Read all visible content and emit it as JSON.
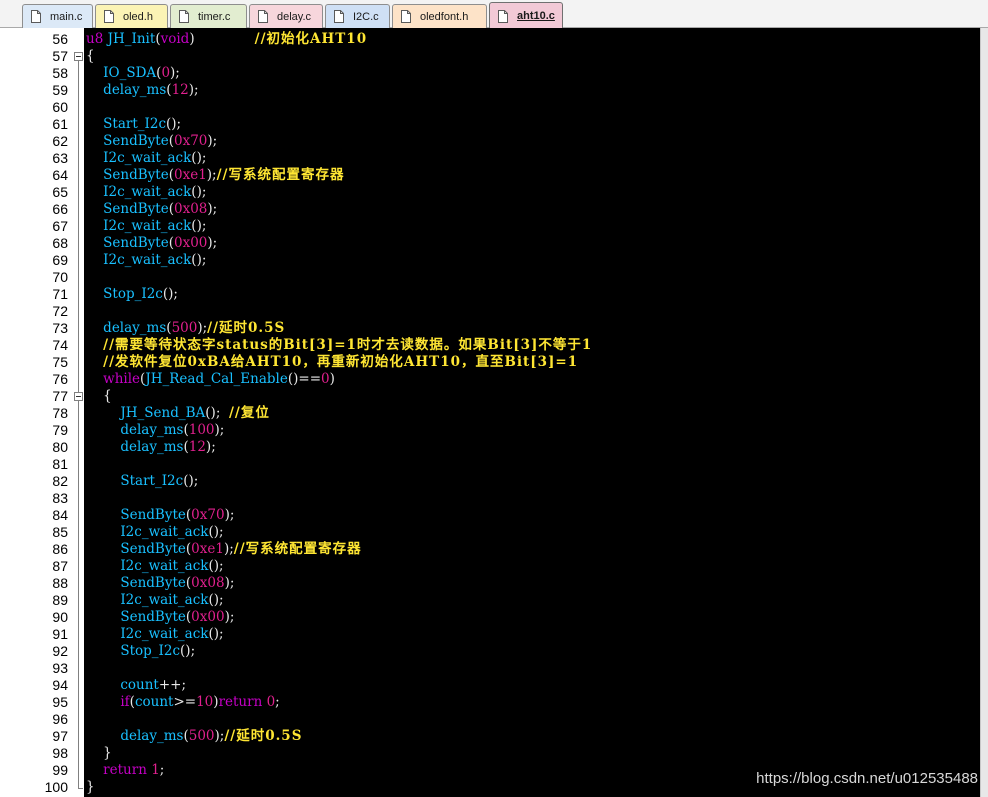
{
  "tabs": [
    {
      "label": "main.c",
      "color": "#dce9f7",
      "active": false
    },
    {
      "label": "oled.h",
      "color": "#fbf3b5",
      "active": false
    },
    {
      "label": "timer.c",
      "color": "#e2edd0",
      "active": false
    },
    {
      "label": "delay.c",
      "color": "#f7d6dc",
      "active": false
    },
    {
      "label": "I2C.c",
      "color": "#cfe0f5",
      "active": false
    },
    {
      "label": "oledfont.h",
      "color": "#fde3c8",
      "active": false
    },
    {
      "label": "aht10.c",
      "color": "#f2c9d6",
      "active": true
    }
  ],
  "editor": {
    "background": "#000000",
    "first_line": 56,
    "lines": [
      {
        "n": "56",
        "indent": "",
        "tokens": [
          [
            "kw",
            "u8"
          ],
          [
            "pun",
            " "
          ],
          [
            "fn",
            "JH_Init"
          ],
          [
            "pun",
            "("
          ],
          [
            "kw",
            "void"
          ],
          [
            "pun",
            ")"
          ],
          [
            "pun",
            "              "
          ],
          [
            "cmt",
            "//初始化AHT10"
          ]
        ]
      },
      {
        "n": "57",
        "indent": "",
        "tokens": [
          [
            "pun",
            "{"
          ]
        ]
      },
      {
        "n": "58",
        "indent": "    ",
        "tokens": [
          [
            "fn",
            "IO_SDA"
          ],
          [
            "pun",
            "("
          ],
          [
            "num",
            "0"
          ],
          [
            "pun",
            ");"
          ]
        ]
      },
      {
        "n": "59",
        "indent": "    ",
        "tokens": [
          [
            "fn",
            "delay_ms"
          ],
          [
            "pun",
            "("
          ],
          [
            "num",
            "12"
          ],
          [
            "pun",
            ");"
          ]
        ]
      },
      {
        "n": "60",
        "indent": "",
        "tokens": []
      },
      {
        "n": "61",
        "indent": "    ",
        "tokens": [
          [
            "fn",
            "Start_I2c"
          ],
          [
            "pun",
            "();"
          ]
        ]
      },
      {
        "n": "62",
        "indent": "    ",
        "tokens": [
          [
            "fn",
            "SendByte"
          ],
          [
            "pun",
            "("
          ],
          [
            "num",
            "0x70"
          ],
          [
            "pun",
            ");"
          ]
        ]
      },
      {
        "n": "63",
        "indent": "    ",
        "tokens": [
          [
            "fn",
            "I2c_wait_ack"
          ],
          [
            "pun",
            "();"
          ]
        ]
      },
      {
        "n": "64",
        "indent": "    ",
        "tokens": [
          [
            "fn",
            "SendByte"
          ],
          [
            "pun",
            "("
          ],
          [
            "num",
            "0xe1"
          ],
          [
            "pun",
            ");"
          ],
          [
            "cmt",
            "//写系统配置寄存器"
          ]
        ]
      },
      {
        "n": "65",
        "indent": "    ",
        "tokens": [
          [
            "fn",
            "I2c_wait_ack"
          ],
          [
            "pun",
            "();"
          ]
        ]
      },
      {
        "n": "66",
        "indent": "    ",
        "tokens": [
          [
            "fn",
            "SendByte"
          ],
          [
            "pun",
            "("
          ],
          [
            "num",
            "0x08"
          ],
          [
            "pun",
            ");"
          ]
        ]
      },
      {
        "n": "67",
        "indent": "    ",
        "tokens": [
          [
            "fn",
            "I2c_wait_ack"
          ],
          [
            "pun",
            "();"
          ]
        ]
      },
      {
        "n": "68",
        "indent": "    ",
        "tokens": [
          [
            "fn",
            "SendByte"
          ],
          [
            "pun",
            "("
          ],
          [
            "num",
            "0x00"
          ],
          [
            "pun",
            ");"
          ]
        ]
      },
      {
        "n": "69",
        "indent": "    ",
        "tokens": [
          [
            "fn",
            "I2c_wait_ack"
          ],
          [
            "pun",
            "();"
          ]
        ]
      },
      {
        "n": "70",
        "indent": "",
        "tokens": []
      },
      {
        "n": "71",
        "indent": "    ",
        "tokens": [
          [
            "fn",
            "Stop_I2c"
          ],
          [
            "pun",
            "();"
          ]
        ]
      },
      {
        "n": "72",
        "indent": "",
        "tokens": []
      },
      {
        "n": "73",
        "indent": "    ",
        "tokens": [
          [
            "fn",
            "delay_ms"
          ],
          [
            "pun",
            "("
          ],
          [
            "num",
            "500"
          ],
          [
            "pun",
            ");"
          ],
          [
            "cmt",
            "//延时0.5S"
          ]
        ]
      },
      {
        "n": "74",
        "indent": "    ",
        "tokens": [
          [
            "cmt",
            "//需要等待状态字status的Bit[3]=1时才去读数据。如果Bit[3]不等于1"
          ]
        ]
      },
      {
        "n": "75",
        "indent": "    ",
        "tokens": [
          [
            "cmt",
            "//发软件复位0xBA给AHT10，再重新初始化AHT10，直至Bit[3]=1"
          ]
        ]
      },
      {
        "n": "76",
        "indent": "    ",
        "tokens": [
          [
            "kw",
            "while"
          ],
          [
            "pun",
            "("
          ],
          [
            "fn",
            "JH_Read_Cal_Enable"
          ],
          [
            "pun",
            "()=="
          ],
          [
            "num",
            "0"
          ],
          [
            "pun",
            ")"
          ]
        ]
      },
      {
        "n": "77",
        "indent": "    ",
        "tokens": [
          [
            "pun",
            "{"
          ]
        ]
      },
      {
        "n": "78",
        "indent": "        ",
        "tokens": [
          [
            "fn",
            "JH_Send_BA"
          ],
          [
            "pun",
            "();  "
          ],
          [
            "cmt",
            "//复位"
          ]
        ]
      },
      {
        "n": "79",
        "indent": "        ",
        "tokens": [
          [
            "fn",
            "delay_ms"
          ],
          [
            "pun",
            "("
          ],
          [
            "num",
            "100"
          ],
          [
            "pun",
            ");"
          ]
        ]
      },
      {
        "n": "80",
        "indent": "        ",
        "tokens": [
          [
            "fn",
            "delay_ms"
          ],
          [
            "pun",
            "("
          ],
          [
            "num",
            "12"
          ],
          [
            "pun",
            ");"
          ]
        ]
      },
      {
        "n": "81",
        "indent": "",
        "tokens": []
      },
      {
        "n": "82",
        "indent": "        ",
        "tokens": [
          [
            "fn",
            "Start_I2c"
          ],
          [
            "pun",
            "();"
          ]
        ]
      },
      {
        "n": "83",
        "indent": "",
        "tokens": []
      },
      {
        "n": "84",
        "indent": "        ",
        "tokens": [
          [
            "fn",
            "SendByte"
          ],
          [
            "pun",
            "("
          ],
          [
            "num",
            "0x70"
          ],
          [
            "pun",
            ");"
          ]
        ]
      },
      {
        "n": "85",
        "indent": "        ",
        "tokens": [
          [
            "fn",
            "I2c_wait_ack"
          ],
          [
            "pun",
            "();"
          ]
        ]
      },
      {
        "n": "86",
        "indent": "        ",
        "tokens": [
          [
            "fn",
            "SendByte"
          ],
          [
            "pun",
            "("
          ],
          [
            "num",
            "0xe1"
          ],
          [
            "pun",
            ");"
          ],
          [
            "cmt",
            "//写系统配置寄存器"
          ]
        ]
      },
      {
        "n": "87",
        "indent": "        ",
        "tokens": [
          [
            "fn",
            "I2c_wait_ack"
          ],
          [
            "pun",
            "();"
          ]
        ]
      },
      {
        "n": "88",
        "indent": "        ",
        "tokens": [
          [
            "fn",
            "SendByte"
          ],
          [
            "pun",
            "("
          ],
          [
            "num",
            "0x08"
          ],
          [
            "pun",
            ");"
          ]
        ]
      },
      {
        "n": "89",
        "indent": "        ",
        "tokens": [
          [
            "fn",
            "I2c_wait_ack"
          ],
          [
            "pun",
            "();"
          ]
        ]
      },
      {
        "n": "90",
        "indent": "        ",
        "tokens": [
          [
            "fn",
            "SendByte"
          ],
          [
            "pun",
            "("
          ],
          [
            "num",
            "0x00"
          ],
          [
            "pun",
            ");"
          ]
        ]
      },
      {
        "n": "91",
        "indent": "        ",
        "tokens": [
          [
            "fn",
            "I2c_wait_ack"
          ],
          [
            "pun",
            "();"
          ]
        ]
      },
      {
        "n": "92",
        "indent": "        ",
        "tokens": [
          [
            "fn",
            "Stop_I2c"
          ],
          [
            "pun",
            "();"
          ]
        ]
      },
      {
        "n": "93",
        "indent": "",
        "tokens": []
      },
      {
        "n": "94",
        "indent": "        ",
        "tokens": [
          [
            "id",
            "count"
          ],
          [
            "pun",
            "++;"
          ]
        ]
      },
      {
        "n": "95",
        "indent": "        ",
        "tokens": [
          [
            "kw",
            "if"
          ],
          [
            "pun",
            "("
          ],
          [
            "id",
            "count"
          ],
          [
            "pun",
            ">="
          ],
          [
            "num",
            "10"
          ],
          [
            "pun",
            ")"
          ],
          [
            "kw",
            "return"
          ],
          [
            "pun",
            " "
          ],
          [
            "num",
            "0"
          ],
          [
            "pun",
            ";"
          ]
        ]
      },
      {
        "n": "96",
        "indent": "",
        "tokens": []
      },
      {
        "n": "97",
        "indent": "        ",
        "tokens": [
          [
            "fn",
            "delay_ms"
          ],
          [
            "pun",
            "("
          ],
          [
            "num",
            "500"
          ],
          [
            "pun",
            ");"
          ],
          [
            "cmt",
            "//延时0.5S"
          ]
        ]
      },
      {
        "n": "98",
        "indent": "    ",
        "tokens": [
          [
            "pun",
            "}"
          ]
        ]
      },
      {
        "n": "99",
        "indent": "    ",
        "tokens": [
          [
            "kw",
            "return"
          ],
          [
            "pun",
            " "
          ],
          [
            "num",
            "1"
          ],
          [
            "pun",
            ";"
          ]
        ]
      },
      {
        "n": "100",
        "indent": "",
        "tokens": [
          [
            "pun",
            "}"
          ]
        ]
      }
    ]
  },
  "watermark": "https://blog.csdn.net/u012535488",
  "icons": {
    "tab_file": "file-icon",
    "fold": "fold-minus-icon"
  }
}
